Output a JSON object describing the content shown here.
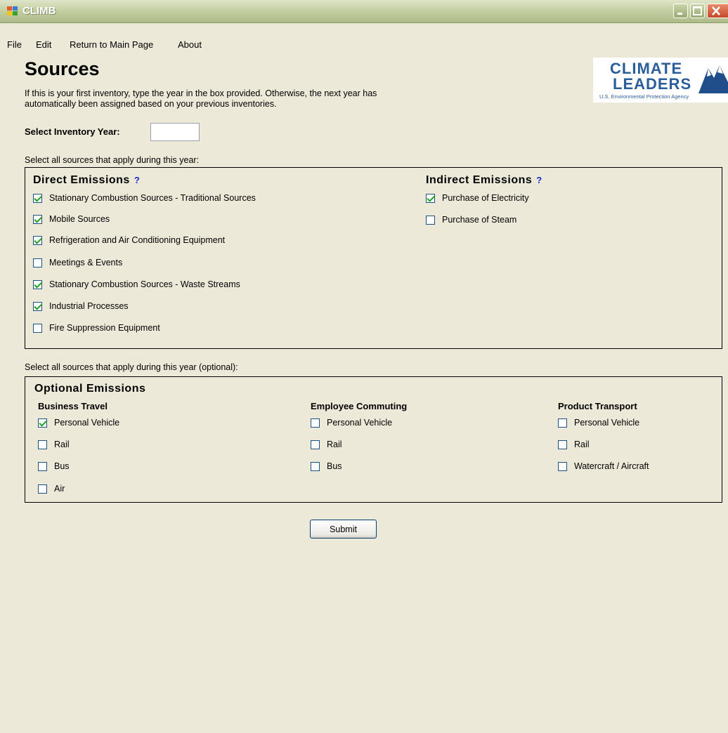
{
  "window": {
    "title": "CLIMB"
  },
  "menu": [
    "File",
    "Edit",
    "Return to Main Page",
    "About"
  ],
  "page": {
    "heading": "Sources",
    "intro_line1": "If this is your first inventory, type the year in the box provided. Otherwise, the next year has",
    "intro_line2": "automatically been assigned based on your previous inventories.",
    "year_label": "Select Inventory Year:",
    "year_value": ""
  },
  "logo": {
    "line1": "CLIMATE",
    "line2": "LEADERS",
    "line3": "U.S. Environmental Protection Agency"
  },
  "required_note": "Select all sources that apply during this year:",
  "direct": {
    "title": "Direct Emissions",
    "help": "?",
    "items": [
      {
        "label": "Stationary Combustion Sources - Traditional Sources",
        "checked": true
      },
      {
        "label": "Mobile Sources",
        "checked": true
      },
      {
        "label": "Refrigeration and Air Conditioning Equipment",
        "checked": true
      },
      {
        "label": "Meetings & Events",
        "checked": false
      },
      {
        "label": "Stationary Combustion Sources - Waste Streams",
        "checked": true
      },
      {
        "label": "Industrial Processes",
        "checked": true
      },
      {
        "label": "Fire Suppression Equipment",
        "checked": false
      }
    ]
  },
  "indirect": {
    "title": "Indirect Emissions",
    "help": "?",
    "items": [
      {
        "label": "Purchase of Electricity",
        "checked": true
      },
      {
        "label": "Purchase of Steam",
        "checked": false
      }
    ]
  },
  "optional_note": "Select all sources that apply during this year (optional):",
  "optional": {
    "title": "Optional Emissions",
    "business_travel": {
      "title": "Business Travel",
      "items": [
        {
          "label": "Personal Vehicle",
          "checked": true
        },
        {
          "label": "Rail",
          "checked": false
        },
        {
          "label": "Bus",
          "checked": false
        },
        {
          "label": "Air",
          "checked": false
        }
      ]
    },
    "employee_commuting": {
      "title": "Employee Commuting",
      "items": [
        {
          "label": "Personal Vehicle",
          "checked": false
        },
        {
          "label": "Rail",
          "checked": false
        },
        {
          "label": "Bus",
          "checked": false
        }
      ]
    },
    "product_transport": {
      "title": "Product Transport",
      "items": [
        {
          "label": "Personal Vehicle",
          "checked": false
        },
        {
          "label": "Rail",
          "checked": false
        },
        {
          "label": "Watercraft / Aircraft",
          "checked": false
        }
      ]
    }
  },
  "submit_label": "Submit",
  "colors": {
    "checkmark": "#21a121",
    "help": "#1a2cc9",
    "logo": "#2b5d9a",
    "background": "#ece9d8"
  },
  "icons": [
    "app-icon",
    "minimize-icon",
    "maximize-icon",
    "close-icon",
    "mountain-logo-icon",
    "checkmark-icon"
  ]
}
